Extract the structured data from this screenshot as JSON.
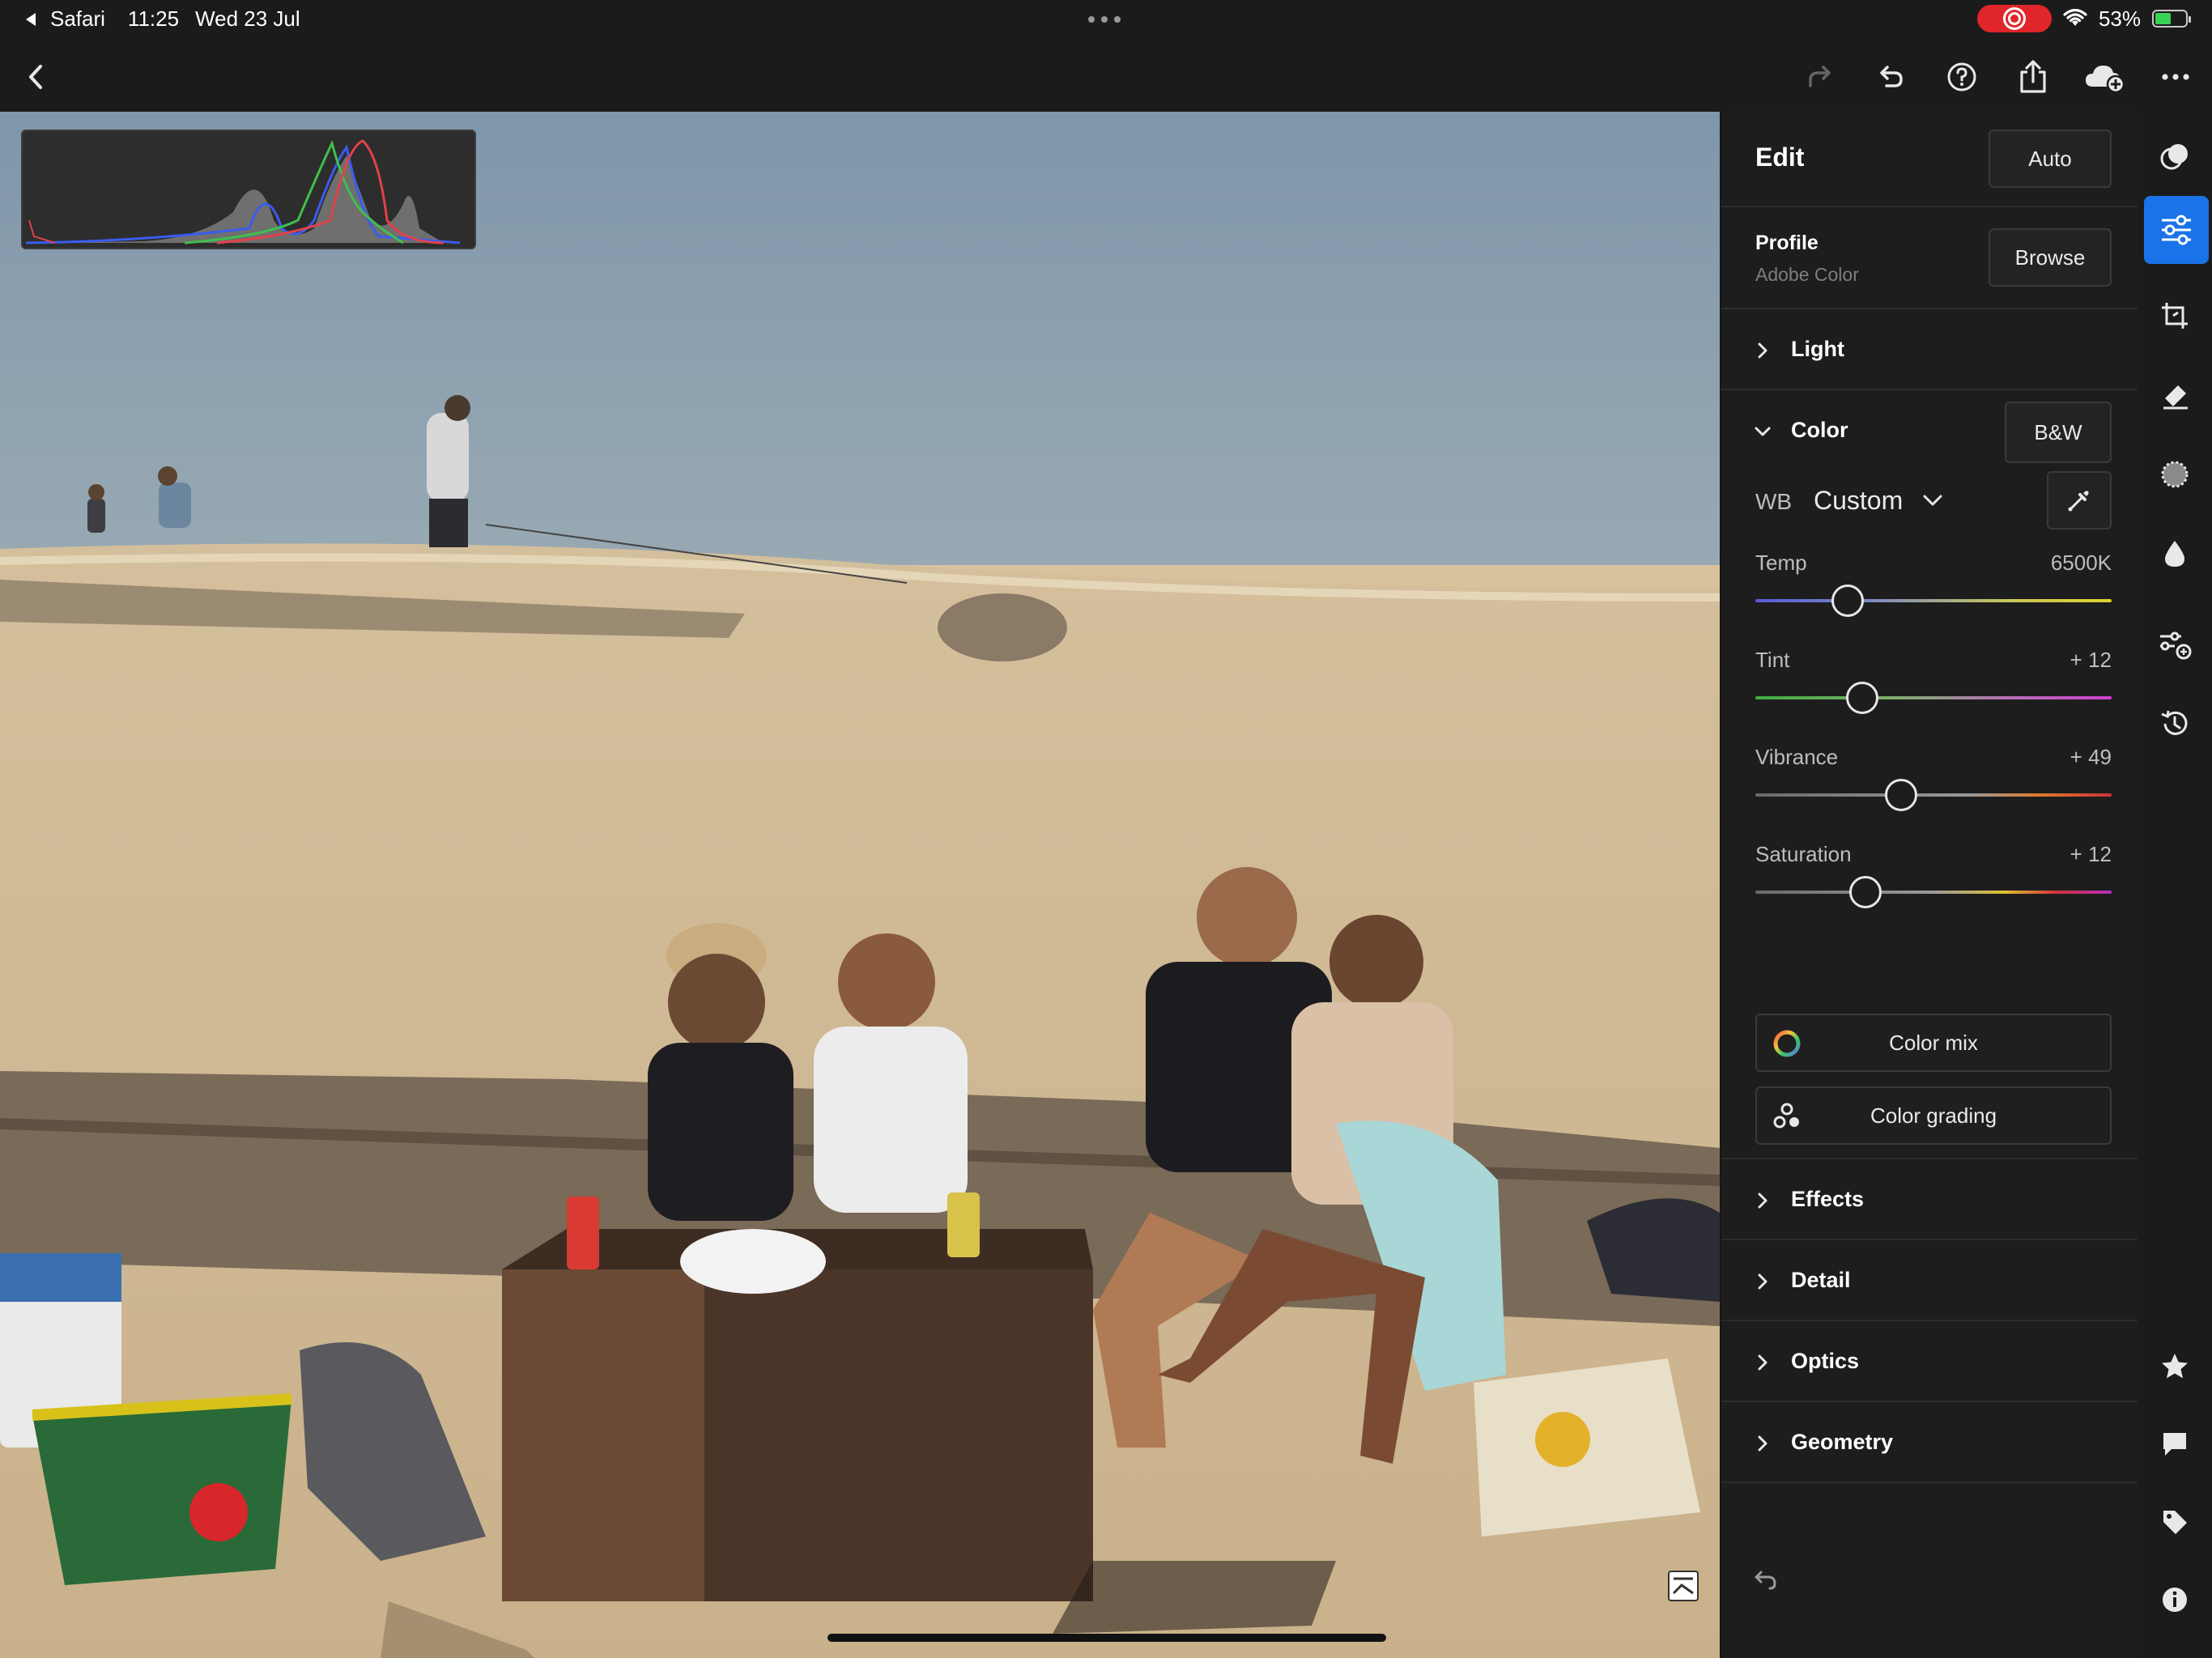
{
  "status_bar": {
    "back_app": "Safari",
    "time": "11:25",
    "date": "Wed 23 Jul",
    "battery": "53%",
    "battery_level": 0.53
  },
  "toolbar": {
    "icons": [
      "back-chevron-icon",
      "redo-icon",
      "undo-icon",
      "help-icon",
      "share-icon",
      "cloud-add-icon",
      "more-icon"
    ]
  },
  "edit_panel": {
    "title": "Edit",
    "auto_label": "Auto",
    "profile": {
      "label": "Profile",
      "value": "Adobe Color",
      "browse_label": "Browse"
    },
    "sections": {
      "light": "Light",
      "color": "Color",
      "effects": "Effects",
      "detail": "Detail",
      "optics": "Optics",
      "geometry": "Geometry"
    },
    "bw_label": "B&W",
    "wb": {
      "label": "WB",
      "value": "Custom"
    },
    "sliders": [
      {
        "label": "Temp",
        "value": "6500K",
        "position": 0.26
      },
      {
        "label": "Tint",
        "value": "+ 12",
        "position": 0.3
      },
      {
        "label": "Vibrance",
        "value": "+ 49",
        "position": 0.41
      },
      {
        "label": "Saturation",
        "value": "+ 12",
        "position": 0.31
      }
    ],
    "color_mix_label": "Color mix",
    "color_grading_label": "Color grading"
  },
  "rail": {
    "icons": [
      "presets-icon",
      "edit-sliders-icon",
      "crop-icon",
      "healing-icon",
      "masking-icon",
      "blur-icon",
      "versions-icon",
      "history-icon",
      "star-icon",
      "comment-icon",
      "tag-icon",
      "info-icon"
    ]
  },
  "colors": {
    "accent_blue": "#1a73e8",
    "panel_bg": "#1d1d1d",
    "record_red": "#e0262b",
    "battery_green": "#39d353"
  }
}
